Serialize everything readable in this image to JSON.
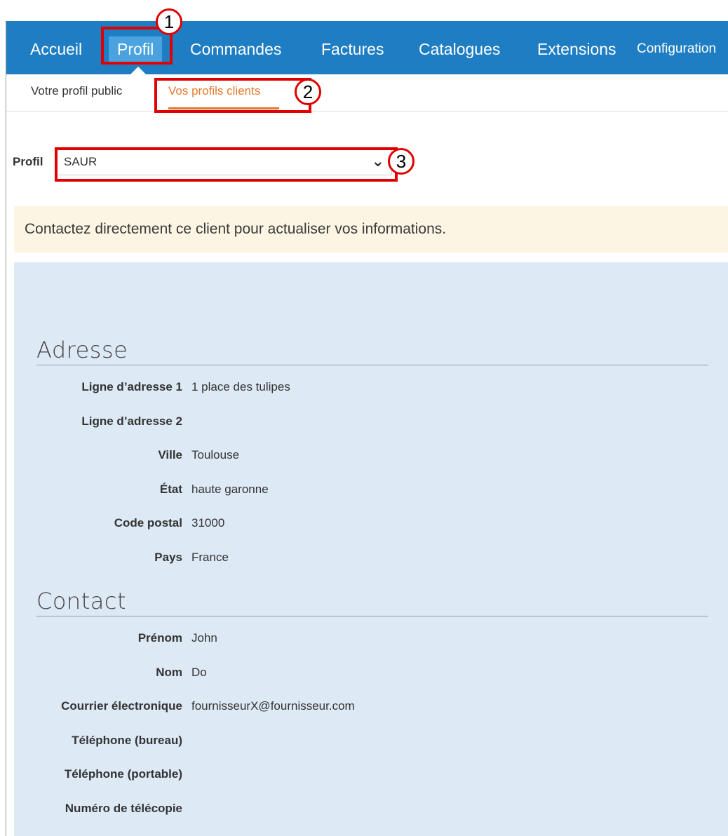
{
  "nav": {
    "items": [
      {
        "label": "Accueil"
      },
      {
        "label": "Profil"
      },
      {
        "label": "Commandes"
      },
      {
        "label": "Factures"
      },
      {
        "label": "Catalogues"
      },
      {
        "label": "Extensions"
      },
      {
        "label": "Configuration"
      }
    ],
    "active": "Profil"
  },
  "subnav": {
    "items": [
      {
        "label": "Votre profil public"
      },
      {
        "label": "Vos profils clients"
      }
    ],
    "active": "Vos profils clients"
  },
  "profile_select": {
    "label": "Profil",
    "value": "SAUR"
  },
  "notice": {
    "text": "Contactez directement ce client pour actualiser vos informations."
  },
  "address": {
    "title": "Adresse",
    "fields": [
      {
        "label": "Ligne d’adresse 1",
        "value": "1 place des tulipes"
      },
      {
        "label": "Ligne d’adresse 2",
        "value": ""
      },
      {
        "label": "Ville",
        "value": "Toulouse"
      },
      {
        "label": "État",
        "value": "haute garonne"
      },
      {
        "label": "Code postal",
        "value": "31000"
      },
      {
        "label": "Pays",
        "value": "France"
      }
    ]
  },
  "contact": {
    "title": "Contact",
    "fields": [
      {
        "label": "Prénom",
        "value": "John"
      },
      {
        "label": "Nom",
        "value": "Do"
      },
      {
        "label": "Courrier électronique",
        "value": "fournisseurX@fournisseur.com"
      },
      {
        "label": "Téléphone (bureau)",
        "value": ""
      },
      {
        "label": "Téléphone (portable)",
        "value": ""
      },
      {
        "label": "Numéro de télécopie",
        "value": ""
      }
    ]
  },
  "annotations": {
    "badges": [
      "1",
      "2",
      "3"
    ],
    "highlight_color": "#e00000"
  },
  "colors": {
    "nav_bg": "#1f7ec3",
    "active_tab_bg": "#4aa3e0",
    "subnav_active": "#e8772e",
    "notice_bg": "#fcf5e3",
    "panel_bg": "#dde9f5"
  }
}
